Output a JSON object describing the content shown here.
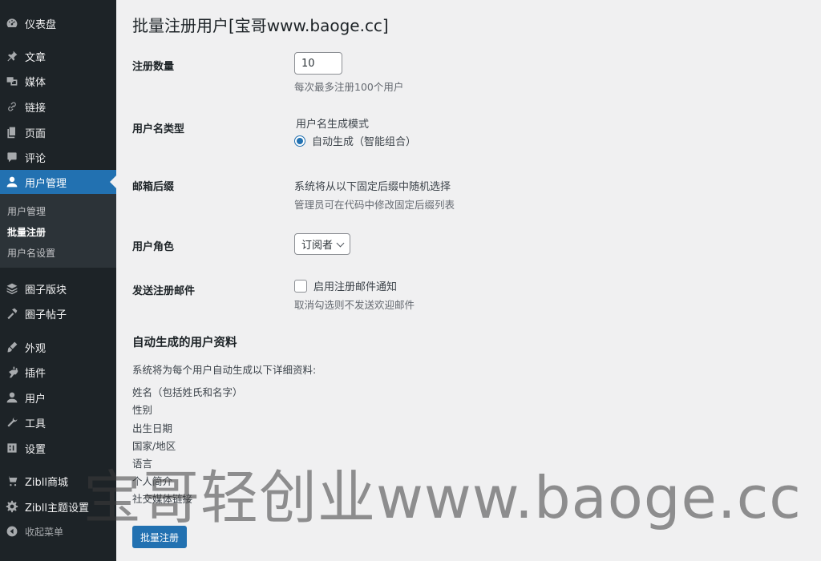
{
  "sidebar": {
    "items": [
      {
        "label": "仪表盘",
        "icon": "dashboard-icon"
      },
      {
        "label": "文章",
        "icon": "pin-icon"
      },
      {
        "label": "媒体",
        "icon": "media-icon"
      },
      {
        "label": "链接",
        "icon": "link-icon"
      },
      {
        "label": "页面",
        "icon": "page-icon"
      },
      {
        "label": "评论",
        "icon": "comment-icon"
      },
      {
        "label": "用户管理",
        "icon": "user-icon"
      },
      {
        "label": "圈子版块",
        "icon": "stack-icon"
      },
      {
        "label": "圈子帖子",
        "icon": "hammer-icon"
      },
      {
        "label": "外观",
        "icon": "brush-icon"
      },
      {
        "label": "插件",
        "icon": "plugin-icon"
      },
      {
        "label": "用户",
        "icon": "user-icon"
      },
      {
        "label": "工具",
        "icon": "wrench-icon"
      },
      {
        "label": "设置",
        "icon": "settings-icon"
      },
      {
        "label": "Zibll商城",
        "icon": "cart-icon"
      },
      {
        "label": "Zibll主题设置",
        "icon": "gear-icon"
      },
      {
        "label": "收起菜单",
        "icon": "collapse-icon"
      }
    ],
    "submenu": [
      "用户管理",
      "批量注册",
      "用户名设置"
    ]
  },
  "page": {
    "title": "批量注册用户[宝哥www.baoge.cc]"
  },
  "form": {
    "count": {
      "label": "注册数量",
      "value": "10",
      "desc": "每次最多注册100个用户"
    },
    "username_type": {
      "label": "用户名类型",
      "mode_title": "用户名生成模式",
      "option": "自动生成（智能组合）"
    },
    "email_suffix": {
      "label": "邮箱后缀",
      "line1": "系统将从以下固定后缀中随机选择",
      "line2": "管理员可在代码中修改固定后缀列表"
    },
    "role": {
      "label": "用户角色",
      "selected": "订阅者"
    },
    "send_email": {
      "label": "发送注册邮件",
      "option": "启用注册邮件通知",
      "desc": "取消勾选则不发送欢迎邮件"
    }
  },
  "profile": {
    "title": "自动生成的用户资料",
    "intro": "系统将为每个用户自动生成以下详细资料:",
    "items": [
      "姓名（包括姓氏和名字）",
      "性别",
      "出生日期",
      "国家/地区",
      "语言",
      "个人简介",
      "社交媒体链接"
    ]
  },
  "submit_label": "批量注册",
  "watermark": "宝哥轻创业www.baoge.cc",
  "colors": {
    "sidebar": "#1d2327",
    "accent": "#2271b1",
    "background": "#f0f0f1"
  }
}
